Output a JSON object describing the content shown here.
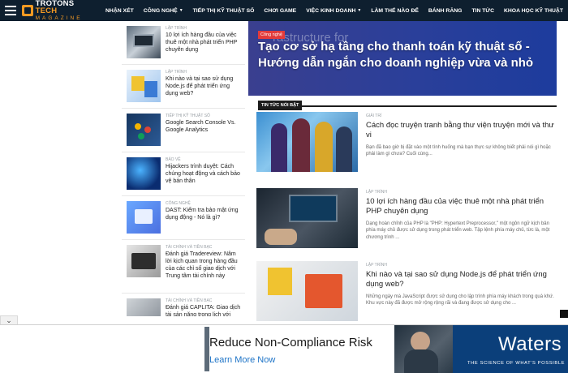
{
  "nav": {
    "logo_top_1": "TROTONS",
    "logo_top_2": "TECH",
    "logo_bottom": "MAGAZINE",
    "items": [
      {
        "label": "NHẬN XÉT",
        "caret": ""
      },
      {
        "label": "CÔNG NGHỆ",
        "caret": "▼"
      },
      {
        "label": "TIẾP THỊ KỸ THUẬT SỐ",
        "caret": ""
      },
      {
        "label": "CHƠI GAME",
        "caret": ""
      },
      {
        "label": "VIỆC KINH DOANH",
        "caret": "▼"
      },
      {
        "label": "LÀM THẾ NÀO ĐỂ",
        "caret": ""
      },
      {
        "label": "BÁNH RĂNG",
        "caret": ""
      },
      {
        "label": "TIN TỨC",
        "caret": ""
      },
      {
        "label": "KHOA HỌC KỸ THUẬT",
        "caret": ""
      }
    ]
  },
  "sidebar": {
    "items": [
      {
        "category": "LẬP TRÌNH",
        "title": "10 lợi ích hàng đầu của việc thuê một nhà phát triển PHP chuyên dụng"
      },
      {
        "category": "LẬP TRÌNH",
        "title": "Khi nào và tại sao sử dụng Node.js để phát triển ứng dụng web?"
      },
      {
        "category": "TIẾP THỊ KỸ THUẬT SỐ",
        "title": "Google Search Console Vs. Google Analytics"
      },
      {
        "category": "BẢO VỆ",
        "title": "Hijackers trình duyệt: Cách chúng hoạt động và cách bảo vệ bản thân"
      },
      {
        "category": "CÔNG NGHỆ",
        "title": "DAST: Kiểm tra bảo mật ứng dụng động - Nó là gì?"
      },
      {
        "category": "TÀI CHÍNH VÀ TIỀN BẠC",
        "title": "Đánh giá Tradereview: Nâm lời kịch quan trong hàng đầu của các chỉ số giao dịch với Trung tâm tài chính này"
      },
      {
        "category": "TÀI CHÍNH VÀ TIỀN BẠC",
        "title": "Đánh giá CAPLITA: Giao dịch tài sản nặng trong lịch với Giao dịch tài sản"
      }
    ]
  },
  "hero": {
    "bg_text": "rastructure for",
    "badge": "Công nghệ",
    "title": "Tạo cơ sở hạ tầng cho thanh toán kỹ thuật số - Hướng dẫn ngắn cho doanh nghiệp vừa và nhỏ"
  },
  "section": {
    "label": "TIN TỨC NỔI BẬT"
  },
  "articles": [
    {
      "category": "GIẢI TRÍ",
      "title": "Cách đọc truyện tranh bằng thư viện truyện mới và thư vi",
      "excerpt": "Bạn đã bao giờ bị đặt vào một tình huống mà bạn thực sự không biết phải nói gì hoặc phải làm gì chưa? Cuối cùng..."
    },
    {
      "category": "LẬP TRÌNH",
      "title": "10 lợi ích hàng đầu của việc thuê một nhà phát triển PHP chuyên dụng",
      "excerpt": "Dạng hoàn chỉnh của PHP là \"PHP: Hypertext Preprocessor,\" một ngôn ngữ kịch bản phía máy chủ được sử dụng trong phát triển web. Tập lệnh phía máy chủ, từc là, một chương trình ..."
    },
    {
      "category": "LẬP TRÌNH",
      "title": "Khi nào và tại sao sử dụng Node.js để phát triển ứng dụng web?",
      "excerpt": "Những ngày mà JavaScript được sử dụng cho lập trình phía máy khách trong quá khứ. Khu vực này đã được mở rộng rộng rãi và đang được sử dụng cho ..."
    }
  ],
  "bottom": {
    "collapse_icon": "⌄"
  },
  "ad": {
    "headline": "Reduce Non-Compliance Risk",
    "link": "Learn More Now",
    "brand": "Waters",
    "tagline": "THE SCIENCE OF WHAT'S POSSIBLE"
  },
  "colors": {
    "nav_bg": "#0e1f2f",
    "accent": "#f59a23",
    "hero_badge": "#e23b3b",
    "ad_link": "#1e74c7",
    "ad_brand_bg": "#0b3f7a"
  }
}
